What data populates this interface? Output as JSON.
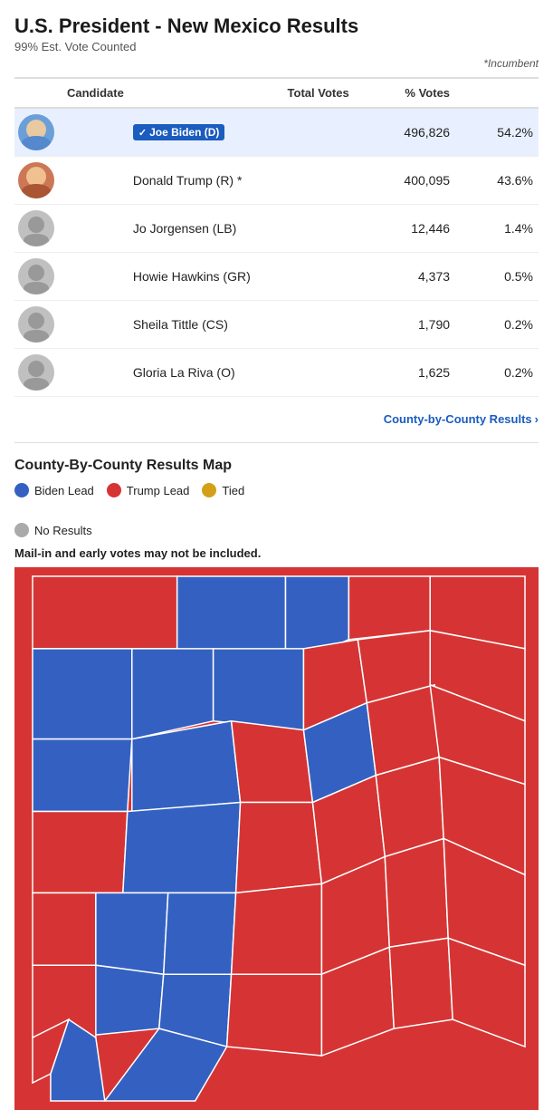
{
  "page": {
    "title": "U.S. President - New Mexico Results",
    "vote_counted": "99% Est. Vote Counted",
    "incumbent_note": "*Incumbent",
    "county_link_label": "County-by-County Results",
    "chevron": "›"
  },
  "table": {
    "headers": {
      "candidate": "Candidate",
      "total_votes": "Total Votes",
      "pct_votes": "% Votes"
    },
    "rows": [
      {
        "id": "biden",
        "name": "Joe Biden (D)",
        "winner": true,
        "winner_label": "✓ Joe Biden (D)",
        "total_votes": "496,826",
        "pct_votes": "54.2%",
        "avatar_type": "biden"
      },
      {
        "id": "trump",
        "name": "Donald Trump (R) *",
        "winner": false,
        "total_votes": "400,095",
        "pct_votes": "43.6%",
        "avatar_type": "trump"
      },
      {
        "id": "jorgensen",
        "name": "Jo Jorgensen (LB)",
        "winner": false,
        "total_votes": "12,446",
        "pct_votes": "1.4%",
        "avatar_type": "generic"
      },
      {
        "id": "hawkins",
        "name": "Howie Hawkins (GR)",
        "winner": false,
        "total_votes": "4,373",
        "pct_votes": "0.5%",
        "avatar_type": "generic"
      },
      {
        "id": "tittle",
        "name": "Sheila Tittle (CS)",
        "winner": false,
        "total_votes": "1,790",
        "pct_votes": "0.2%",
        "avatar_type": "generic"
      },
      {
        "id": "lariva",
        "name": "Gloria La Riva (O)",
        "winner": false,
        "total_votes": "1,625",
        "pct_votes": "0.2%",
        "avatar_type": "generic"
      }
    ]
  },
  "map_section": {
    "title": "County-By-County Results Map",
    "legend": [
      {
        "id": "biden-lead",
        "color": "blue",
        "label": "Biden Lead"
      },
      {
        "id": "trump-lead",
        "color": "red",
        "label": "Trump Lead"
      },
      {
        "id": "tied",
        "color": "gold",
        "label": "Tied"
      },
      {
        "id": "no-results",
        "color": "gray",
        "label": "No Results"
      }
    ],
    "mail_in_note": "Mail-in and early votes may not be included."
  }
}
